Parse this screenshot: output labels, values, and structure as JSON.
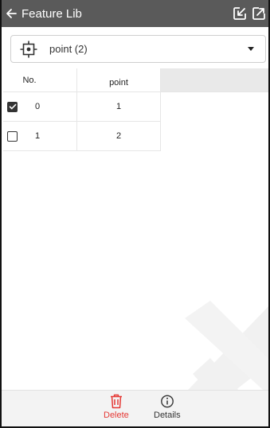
{
  "header": {
    "title": "Feature Lib",
    "icons": [
      "back-arrow-icon",
      "import-icon",
      "export-icon"
    ]
  },
  "dropdown": {
    "icon": "crosshair-point-icon",
    "value": "point (2)"
  },
  "table": {
    "columns": [
      "No.",
      "point"
    ],
    "rows": [
      {
        "checked": true,
        "no": "0",
        "point": "1"
      },
      {
        "checked": false,
        "no": "1",
        "point": "2"
      }
    ]
  },
  "bottom_bar": {
    "delete_label": "Delete",
    "details_label": "Details"
  },
  "colors": {
    "titlebar": "#5a5a5a",
    "delete_accent": "#e53935"
  }
}
